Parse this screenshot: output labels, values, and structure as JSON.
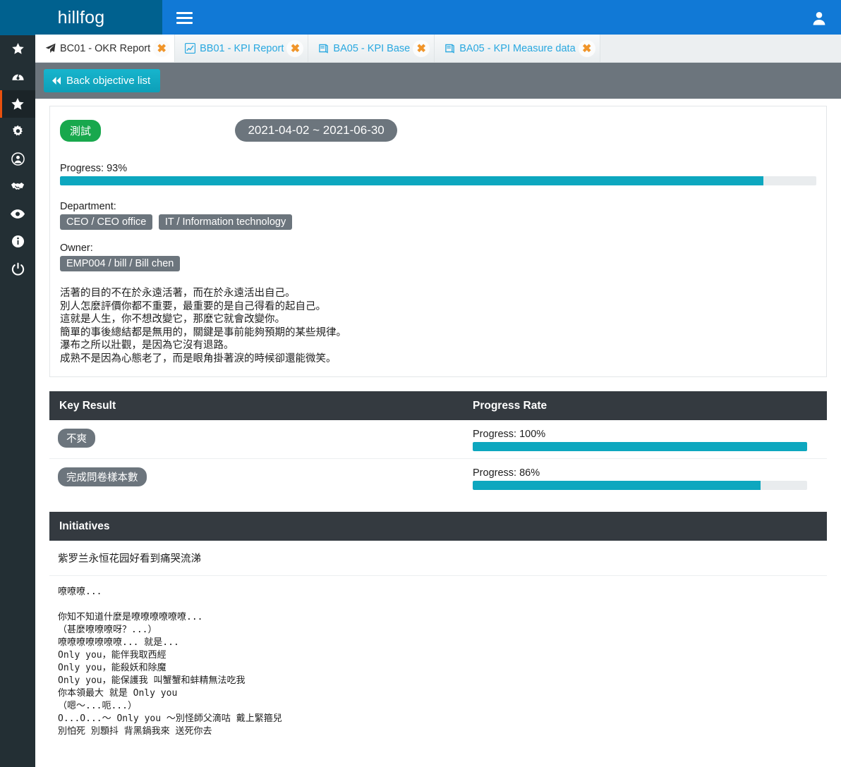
{
  "header": {
    "logo": "hillfog",
    "menu_icon": "hamburger-icon",
    "user_icon": "user-icon",
    "colors": {
      "logo_bg": "#00618f",
      "bar_bg": "#1179d6"
    }
  },
  "sidebar": {
    "items": [
      {
        "icon": "star-icon",
        "active": false
      },
      {
        "icon": "dashboard-icon",
        "active": false
      },
      {
        "icon": "star-icon",
        "active": true
      },
      {
        "icon": "gear-icon",
        "active": false
      },
      {
        "icon": "user-circle-icon",
        "active": false
      },
      {
        "icon": "handshake-icon",
        "active": false
      },
      {
        "icon": "eye-icon",
        "active": false
      },
      {
        "icon": "info-circle-icon",
        "active": false
      },
      {
        "icon": "power-icon",
        "active": false
      }
    ],
    "active_accent": "#e8500e"
  },
  "tabs": [
    {
      "label": "BC01 - OKR Report",
      "icon": "paper-plane-icon",
      "active": true,
      "close": "✖"
    },
    {
      "label": "BB01 - KPI Report",
      "icon": "chart-line-icon",
      "active": false,
      "close": "✖"
    },
    {
      "label": "BA05 - KPI Base",
      "icon": "book-icon",
      "active": false,
      "close": "✖"
    },
    {
      "label": "BA05 - KPI Measure data",
      "icon": "book-icon",
      "active": false,
      "close": "✖"
    }
  ],
  "subbar": {
    "back_button": "Back objective list",
    "back_icon": "double-chevron-left-icon"
  },
  "objective": {
    "status_badge": "測試",
    "date_range": "2021-04-02 ~ 2021-06-30",
    "progress_label": "Progress: 93%",
    "progress_percent": 93,
    "department_label": "Department:",
    "departments": [
      "CEO / CEO office",
      "IT / Information technology"
    ],
    "owner_label": "Owner:",
    "owners": [
      "EMP004 / bill / Bill chen"
    ],
    "description_lines": [
      "活著的目的不在於永遠活著，而在於永遠活出自己。",
      "別人怎麼評價你都不重要，最重要的是自己得看的起自己。",
      "這就是人生，你不想改變它，那麼它就會改變你。",
      "簡單的事後總結都是無用的，關鍵是事前能夠預期的某些規律。",
      "瀑布之所以壯觀，是因為它沒有退路。",
      "成熟不是因為心態老了，而是眼角掛著淚的時候卻還能微笑。"
    ]
  },
  "key_result_section": {
    "col_a_header": "Key Result",
    "col_b_header": "Progress Rate",
    "rows": [
      {
        "name": "不爽",
        "progress_label": "Progress: 100%",
        "progress_percent": 100
      },
      {
        "name": "完成問卷樣本數",
        "progress_label": "Progress: 86%",
        "progress_percent": 86
      }
    ]
  },
  "initiatives_section": {
    "header": "Initiatives",
    "rows": [
      {
        "type": "plain",
        "text": "紫罗兰永恒花园好看到痛哭流涕"
      },
      {
        "type": "mono",
        "text": "嘹嘹嘹...\n\n你知不知道什麼是嘹嘹嘹嘹嘹嘹...\n（甚麼嘹嘹嘹呀？...）\n嘹嘹嘹嘹嘹嘹嘹... 就是...\nOnly you，能伴我取西經\nOnly you，能殺妖和除魔\nOnly you，能保護我 叫蟹蟹和蚌精無法吃我\n你本領最大 就是 Only you\n（嗯～...呃...）\nO...O...～ Only you ～別怪師父滴咕 戴上緊箍兒\n別怕死 別顋抖 背黑鍋我來 送死你去"
      }
    ]
  },
  "theme": {
    "progress_fill": "#0da7bf",
    "progress_track": "#e9ecee",
    "section_header_bg": "#343a40",
    "badge_grey": "#6c757d",
    "badge_green": "#18a84d",
    "tab_link": "#29a8e0",
    "tab_close": "#f0952a"
  }
}
